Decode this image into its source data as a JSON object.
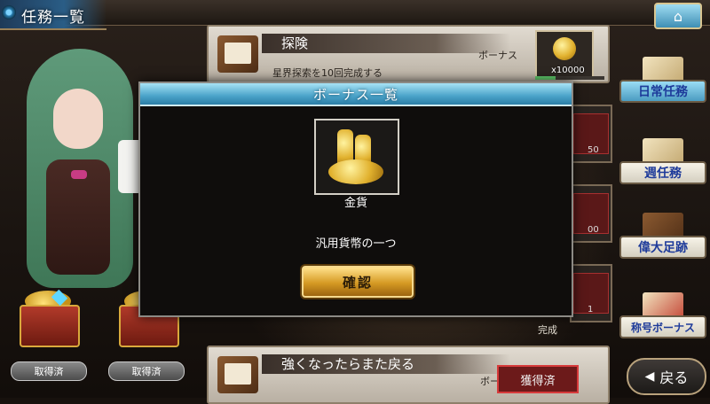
{
  "header": {
    "title": "任務一覧",
    "home_icon": "home-icon"
  },
  "missions": [
    {
      "title": "探険",
      "description": "星界探索を10回完成する",
      "bonus_label": "ボーナス",
      "reward_count": "x10000",
      "progress": 0.3
    },
    {
      "title": "強くなったらまた戻る",
      "bonus_label": "ボー",
      "stamp": "獲得済"
    }
  ],
  "peek": {
    "count_a": "50",
    "count_b": "00",
    "count_c": "1",
    "done_label": "完成"
  },
  "chests": [
    {
      "label": "取得済"
    },
    {
      "label": "取得済"
    }
  ],
  "side_nav": [
    {
      "label": "日常任務",
      "active": true
    },
    {
      "label": "週任務",
      "active": false
    },
    {
      "label": "偉大足跡",
      "active": false
    },
    {
      "label": "称号ボーナス",
      "active": false
    }
  ],
  "back_button": {
    "label": "戻る"
  },
  "dialog": {
    "title": "ボーナス一覧",
    "item_name": "金貨",
    "item_description": "汎用貨幣の一つ",
    "confirm_label": "確認"
  }
}
